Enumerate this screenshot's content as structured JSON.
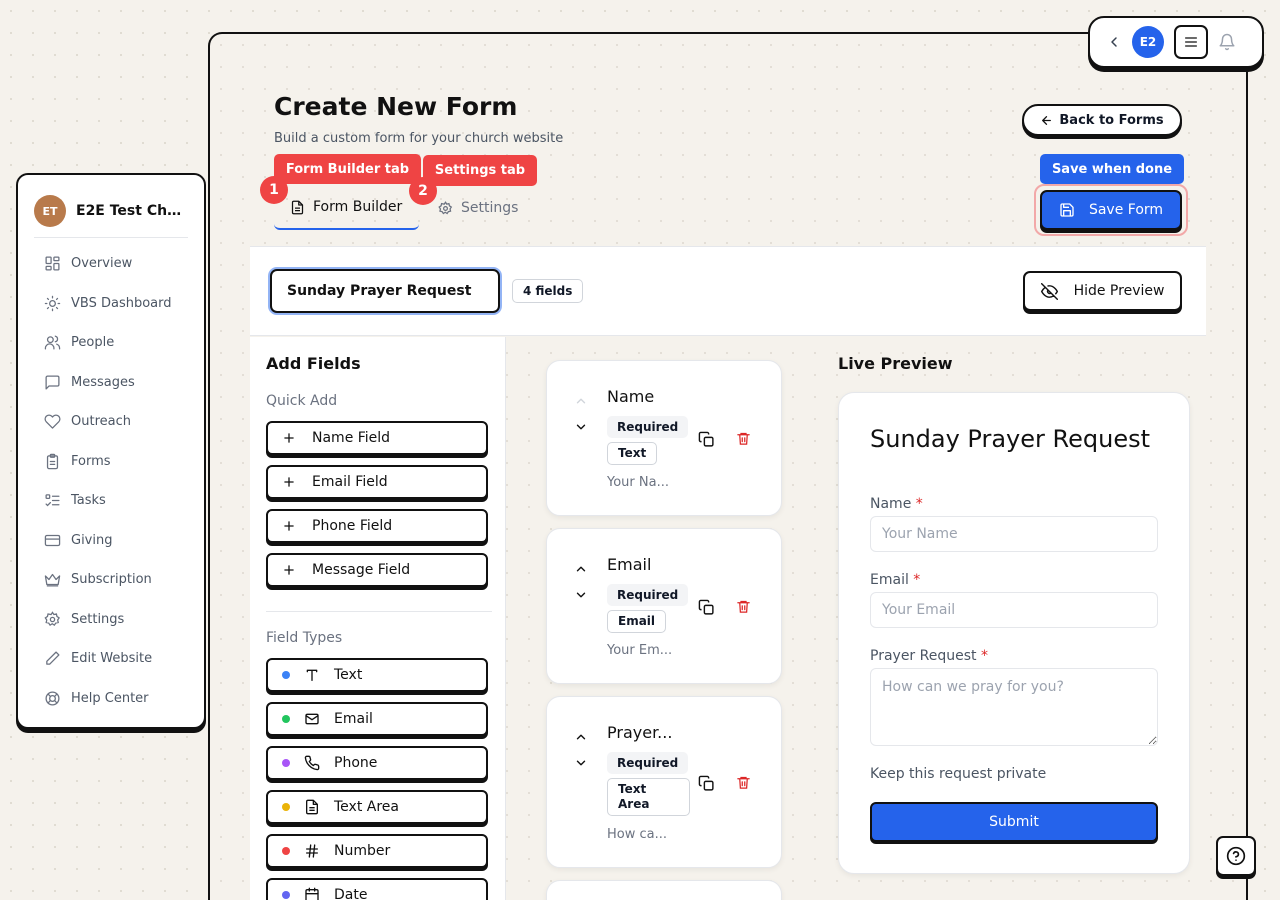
{
  "topbar": {
    "avatar_initials": "E2"
  },
  "sidebar": {
    "org_initials": "ET",
    "org_name": "E2E Test Church",
    "items": [
      {
        "label": "Overview",
        "icon": "grid-icon"
      },
      {
        "label": "VBS Dashboard",
        "icon": "sun-icon"
      },
      {
        "label": "People",
        "icon": "users-icon"
      },
      {
        "label": "Messages",
        "icon": "message-icon"
      },
      {
        "label": "Outreach",
        "icon": "heart-icon"
      },
      {
        "label": "Forms",
        "icon": "clipboard-icon"
      },
      {
        "label": "Tasks",
        "icon": "tasks-icon"
      },
      {
        "label": "Giving",
        "icon": "card-icon"
      },
      {
        "label": "Subscription",
        "icon": "crown-icon"
      },
      {
        "label": "Settings",
        "icon": "gear-icon"
      },
      {
        "label": "Edit Website",
        "icon": "pencil-icon"
      },
      {
        "label": "Help Center",
        "icon": "lifebuoy-icon"
      }
    ]
  },
  "header": {
    "title": "Create New Form",
    "subtitle": "Build a custom form for your church website",
    "back_label": "Back to Forms",
    "save_label": "Save Form"
  },
  "annotations": {
    "tab1_label": "Form Builder tab",
    "tab1_num": "1",
    "tab2_label": "Settings tab",
    "tab2_num": "2",
    "save_hint": "Save when done"
  },
  "tabs": {
    "builder": "Form Builder",
    "settings": "Settings"
  },
  "form": {
    "name": "Sunday Prayer Request",
    "field_count": "4 fields",
    "hide_preview": "Hide Preview"
  },
  "add_fields": {
    "title": "Add Fields",
    "quick_add_title": "Quick Add",
    "quick_add": [
      "Name Field",
      "Email Field",
      "Phone Field",
      "Message Field"
    ],
    "field_types_title": "Field Types",
    "field_types": [
      {
        "label": "Text",
        "color": "#3b82f6",
        "icon": "text-icon"
      },
      {
        "label": "Email",
        "color": "#22c55e",
        "icon": "mail-icon"
      },
      {
        "label": "Phone",
        "color": "#a855f7",
        "icon": "phone-icon"
      },
      {
        "label": "Text Area",
        "color": "#eab308",
        "icon": "file-text-icon"
      },
      {
        "label": "Number",
        "color": "#ef4444",
        "icon": "hash-icon"
      },
      {
        "label": "Date",
        "color": "#6366f1",
        "icon": "calendar-icon"
      }
    ]
  },
  "canvas": {
    "fields": [
      {
        "title": "Name",
        "required": "Required",
        "type": "Text",
        "placeholder": "Your Na..."
      },
      {
        "title": "Email",
        "required": "Required",
        "type": "Email",
        "placeholder": "Your Em..."
      },
      {
        "title": "Prayer...",
        "required": "Required",
        "type": "Text Area",
        "placeholder": "How ca..."
      }
    ]
  },
  "preview": {
    "section_title": "Live Preview",
    "form_title": "Sunday Prayer Request",
    "fields": [
      {
        "label": "Name",
        "required_mark": "*",
        "placeholder": "Your Name"
      },
      {
        "label": "Email",
        "required_mark": "*",
        "placeholder": "Your Email"
      },
      {
        "label": "Prayer Request",
        "required_mark": "*",
        "placeholder": "How can we pray for you?"
      }
    ],
    "private_label": "Keep this request private",
    "submit_label": "Submit"
  },
  "colors": {
    "accent": "#2563eb",
    "annotation": "#ef4444",
    "danger": "#dc2626"
  }
}
